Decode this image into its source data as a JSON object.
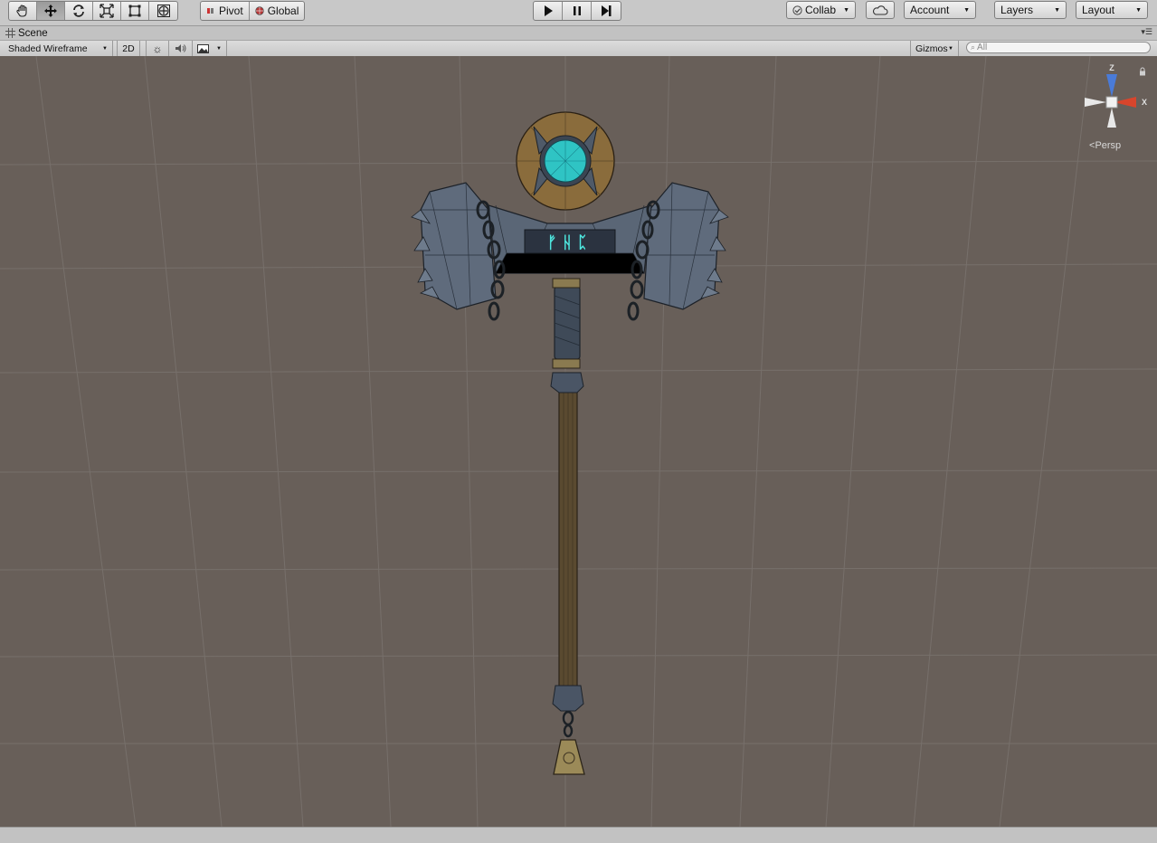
{
  "toolbar": {
    "tools": [
      {
        "name": "hand-tool",
        "icon": "hand-icon"
      },
      {
        "name": "move-tool",
        "icon": "move-icon"
      },
      {
        "name": "rotate-tool",
        "icon": "rotate-icon"
      },
      {
        "name": "scale-tool",
        "icon": "scale-icon"
      },
      {
        "name": "rect-tool",
        "icon": "rect-icon"
      },
      {
        "name": "transform-tool",
        "icon": "transform-icon"
      }
    ],
    "active_tool": "move-tool",
    "pivot_label": "Pivot",
    "global_label": "Global",
    "collab_label": "Collab",
    "account_label": "Account",
    "layers_label": "Layers",
    "layout_label": "Layout"
  },
  "tab": {
    "title": "Scene"
  },
  "scene_toolbar": {
    "draw_mode": "Shaded Wireframe",
    "mode_2d": "2D",
    "gizmos_label": "Gizmos",
    "search_placeholder": "All"
  },
  "viewport": {
    "background": "#685f59",
    "projection_label": "Persp",
    "axis_labels": {
      "z": "Z",
      "x": "X"
    },
    "axis_colors": {
      "z": "#4a7bd8",
      "x": "#d8452c",
      "neutral": "#e8e8e8"
    },
    "rune_text": "ᚠᚺᛈ",
    "rune_color": "#4ee8e0"
  }
}
